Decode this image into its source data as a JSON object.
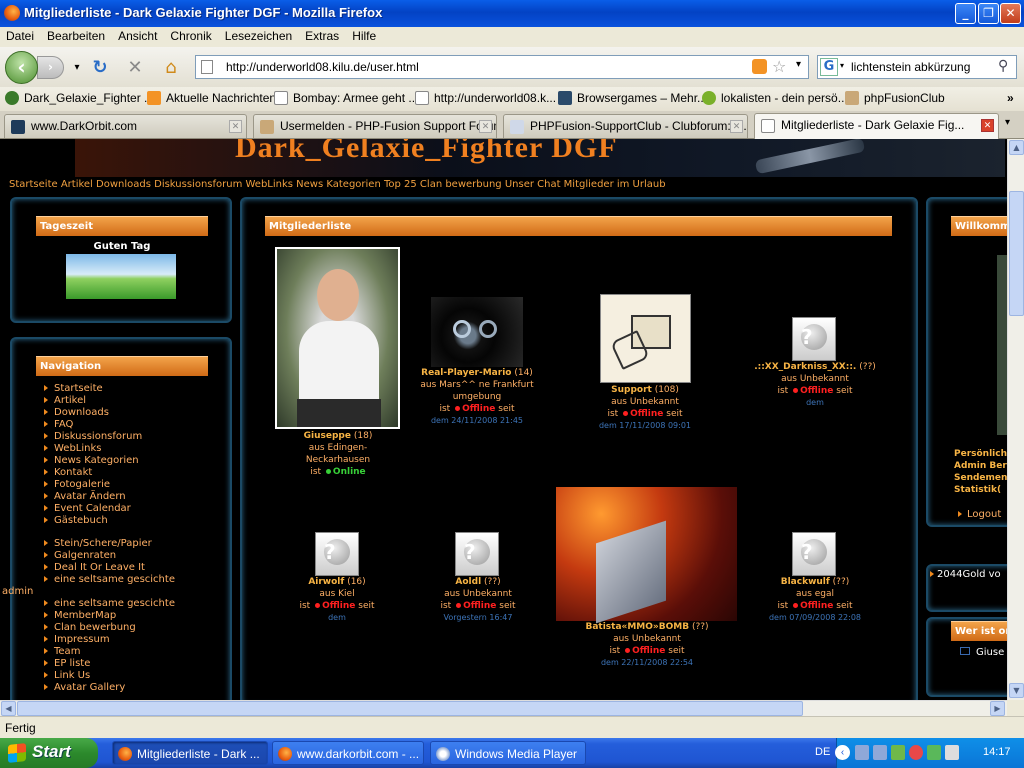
{
  "window": {
    "title": "Mitgliederliste - Dark Gelaxie Fighter DGF - Mozilla Firefox"
  },
  "menu": [
    "Datei",
    "Bearbeiten",
    "Ansicht",
    "Chronik",
    "Lesezeichen",
    "Extras",
    "Hilfe"
  ],
  "toolbar": {
    "url": "http://underworld08.kilu.de/user.html",
    "search": "lichtenstein abkürzung"
  },
  "bookmarks": [
    "Dark_Gelaxie_Fighter ...",
    "Aktuelle Nachrichten",
    "Bombay: Armee geht ...",
    "http://underworld08.k...",
    "Browsergames – Mehr...",
    "lokalisten - dein persö...",
    "phpFusionClub"
  ],
  "tabs": [
    "www.DarkOrbit.com",
    "Usermelden - PHP-Fusion Support Forum",
    "PHPFusion-SupportClub - Clubforum: O...",
    "Mitgliederliste - Dark Gelaxie Fig..."
  ],
  "site": {
    "banner": "Dark_Gelaxie_Fighter DGF",
    "topnav": "Startseite Artikel Downloads Diskussionsforum WebLinks News Kategorien Top 25 Clan bewerbung Unser Chat Mitglieder im Urlaub",
    "tageszeit": {
      "title": "Tageszeit",
      "greeting": "Guten Tag"
    },
    "navigation": {
      "title": "Navigation",
      "items": [
        "Startseite",
        "Artikel",
        "Downloads",
        "FAQ",
        "Diskussionsforum",
        "WebLinks",
        "News Kategorien",
        "Kontakt",
        "Fotogalerie",
        "Avatar Ändern",
        "Event Calendar",
        "Gästebuch"
      ],
      "items2": [
        "Stein/Schere/Papier",
        "Galgenraten",
        "Deal It Or Leave It",
        "eine seltsame gescichte",
        "admin",
        "eine seltsame gescichte",
        "MemberMap",
        "Clan bewerbung",
        "Impressum",
        "Team",
        "EP liste",
        "Link Us",
        "Avatar Gallery"
      ]
    },
    "main_title": "Mitgliederliste",
    "right": {
      "title": "Willkomm",
      "lines": [
        "Persönliche",
        "Admin Ber",
        "Sendemen",
        "Statistik("
      ],
      "logout": "Logout",
      "gold": "2044Gold vo",
      "wer_title": "Wer ist onl",
      "wer_user": "Giuse"
    }
  },
  "members": [
    {
      "name": "Giuseppe",
      "count": "(18)",
      "from1": "aus Edingen-",
      "from2": "Neckarhausen",
      "status": "Online",
      "date": ""
    },
    {
      "name": "Real-Player-Mario",
      "count": "(14)",
      "from1": "aus Mars^^ ne Frankfurt",
      "from2": "umgebung",
      "status": "Offline",
      "date": "dem 24/11/2008 21:45"
    },
    {
      "name": "Support",
      "count": "(108)",
      "from1": "aus Unbekannt",
      "from2": "",
      "status": "Offline",
      "date": "dem 17/11/2008 09:01"
    },
    {
      "name": ".::XX_Darkniss_XX::.",
      "count": "(??)",
      "from1": "aus Unbekannt",
      "from2": "",
      "status": "Offline",
      "date": "dem"
    },
    {
      "name": "Airwolf",
      "count": "(16)",
      "from1": "aus Kiel",
      "from2": "",
      "status": "Offline",
      "date": "dem"
    },
    {
      "name": "Aoldl",
      "count": "(??)",
      "from1": "aus Unbekannt",
      "from2": "",
      "status": "Offline",
      "date": "Vorgestern 16:47"
    },
    {
      "name": "Batista«MMO»BOMB",
      "count": "(??)",
      "from1": "aus Unbekannt",
      "from2": "",
      "status": "Offline",
      "date": "dem 22/11/2008 22:54"
    },
    {
      "name": "Blackwulf",
      "count": "(??)",
      "from1": "aus egal",
      "from2": "",
      "status": "Offline",
      "date": "dem 07/09/2008 22:08"
    }
  ],
  "labels": {
    "ist": "ist",
    "seit": "seit"
  },
  "status_bar": "Fertig",
  "taskbar": {
    "start": "Start",
    "tasks": [
      "Mitgliederliste - Dark ...",
      "www.darkorbit.com - ...",
      "Windows Media Player"
    ],
    "lang": "DE",
    "clock": "14:17"
  }
}
